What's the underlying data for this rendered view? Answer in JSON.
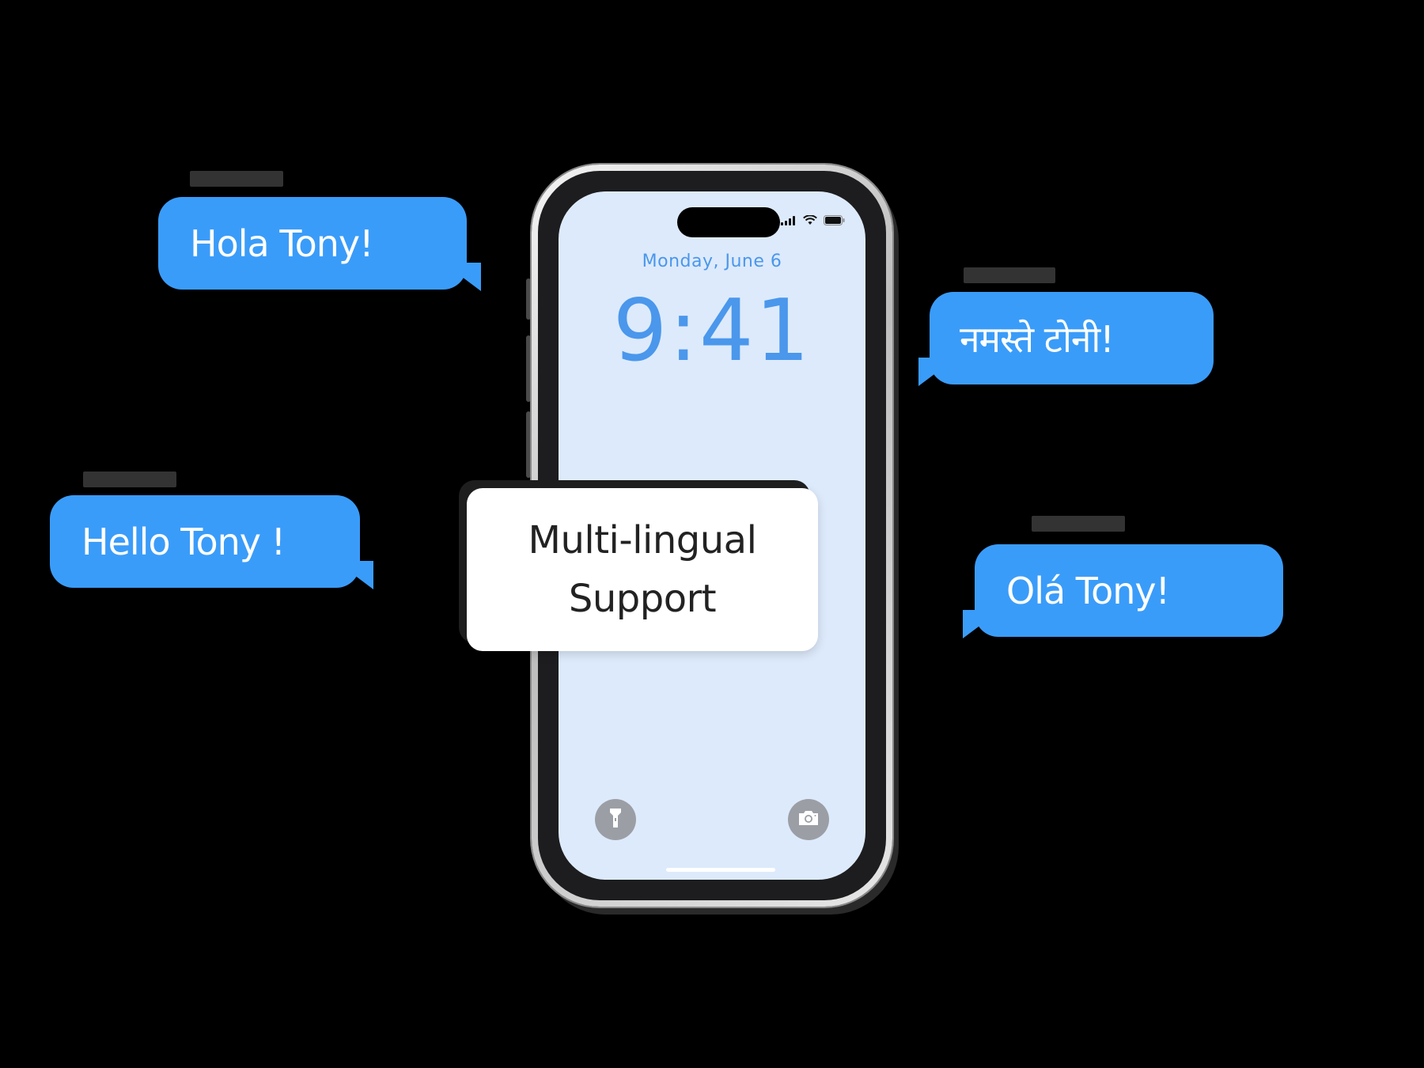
{
  "bubbles": [
    {
      "text": "Hola Tony!"
    },
    {
      "text": "नमस्ते टोनी!"
    },
    {
      "text": "Hello Tony !"
    },
    {
      "text": "Olá Tony!"
    }
  ],
  "phone": {
    "date": "Monday, June 6",
    "time": "9:41",
    "lock_buttons": [
      "flashlight-icon",
      "camera-icon"
    ]
  },
  "feature": {
    "line1": "Multi-lingual",
    "line2": "Support"
  },
  "colors": {
    "bubble": "#3a9cf9",
    "screen": "#ddeafb",
    "accent_text": "#4a97ec",
    "card": "#ffffff",
    "background": "#000000"
  }
}
